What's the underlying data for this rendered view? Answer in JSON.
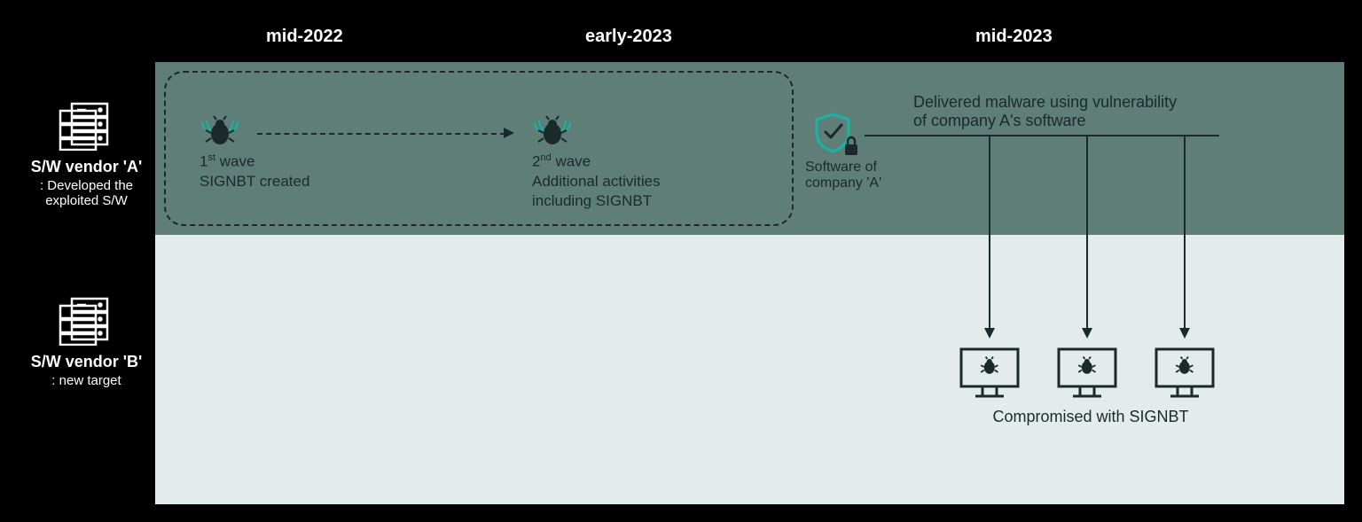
{
  "timeline": {
    "t1": "mid-2022",
    "t2": "early-2023",
    "t3": "mid-2023"
  },
  "vendors": {
    "a": {
      "title": "S/W vendor 'A'",
      "sub": ": Developed the exploited S/W"
    },
    "b": {
      "title": "S/W vendor 'B'",
      "sub": ": new target"
    }
  },
  "waves": {
    "w1": {
      "label_prefix": "1",
      "label_suffix": "st",
      "label_rest": " wave",
      "desc": "SIGNBT created"
    },
    "w2": {
      "label_prefix": "2",
      "label_suffix": "nd",
      "label_rest": " wave",
      "desc1": "Additional activities",
      "desc2": "including SIGNBT"
    }
  },
  "software": {
    "line1": "Software of",
    "line2": "company 'A'"
  },
  "delivery": {
    "line1": "Delivered malware using vulnerability",
    "line2": "of company A's software"
  },
  "compromised": "Compromised with SIGNBT",
  "icons": {
    "server": "server-icon",
    "bug": "bug-icon",
    "shield": "shield-icon",
    "monitor": "monitor-icon"
  }
}
